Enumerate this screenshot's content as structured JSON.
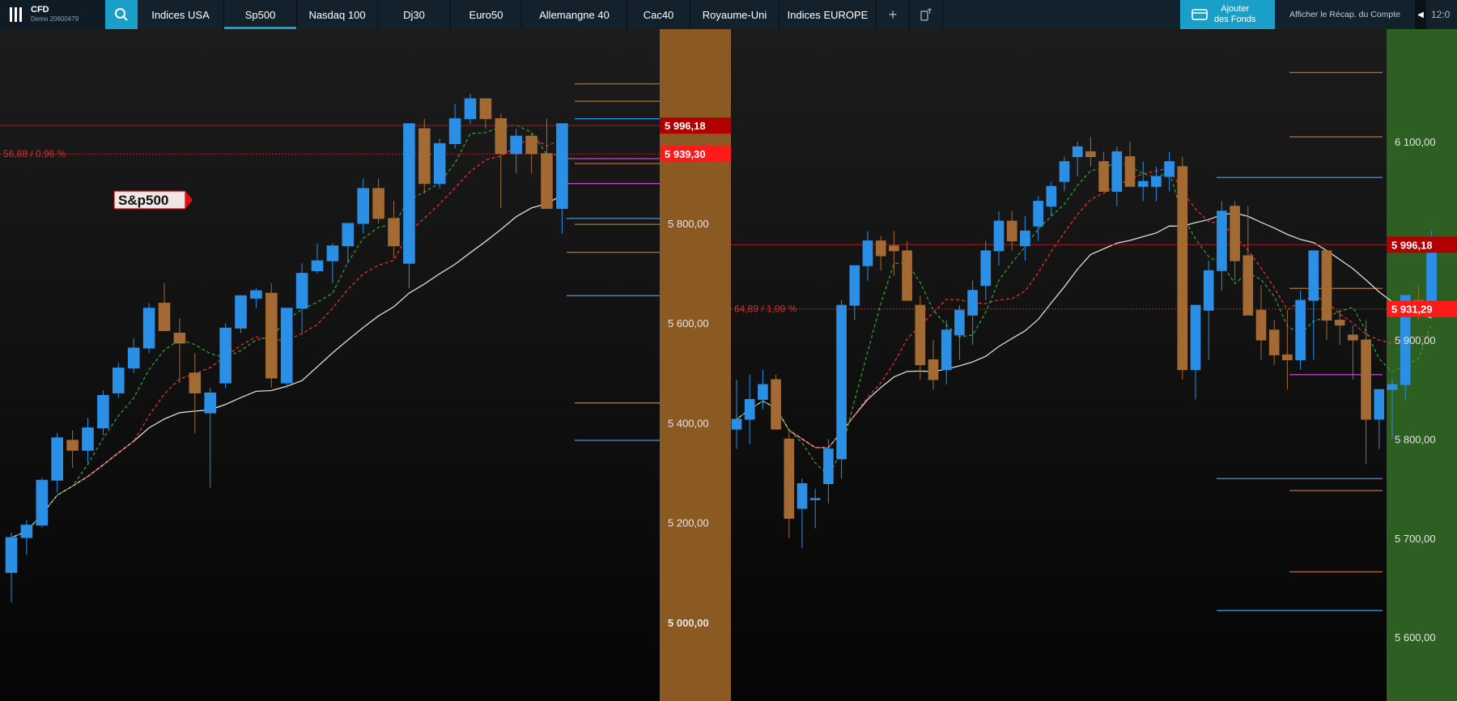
{
  "header": {
    "app_name": "CFD",
    "account": "Demo 20600479",
    "tabs": [
      {
        "label": "Indices USA",
        "active": false
      },
      {
        "label": "Sp500",
        "active": true
      },
      {
        "label": "Nasdaq 100",
        "active": false
      },
      {
        "label": "Dj30",
        "active": false
      },
      {
        "label": "Euro50",
        "active": false
      },
      {
        "label": "Allemangne 40",
        "active": false
      },
      {
        "label": "Cac40",
        "active": false
      },
      {
        "label": "Royaume-Uni",
        "active": false
      },
      {
        "label": "Indices EUROPE",
        "active": false
      }
    ],
    "add_tab": "+",
    "fund_button": "Ajouter\ndes Fonds",
    "recap_link": "Afficher le Récap. du Compte",
    "clock": "12:0"
  },
  "left_chart": {
    "symbol": "S&p500",
    "change_label": "56,88 / 0,96 %",
    "price_tags": [
      "5 996,18",
      "5 939,30"
    ],
    "y_labels": [
      "5 800,00",
      "5 600,00",
      "5 400,00",
      "5 200,00",
      "5 000,00"
    ],
    "axis_color": "#8b5a22"
  },
  "right_chart": {
    "change_label": "64,89 / 1,09 %",
    "price_tags": [
      "5 996,18",
      "5 931,29"
    ],
    "y_labels": [
      "6 100,00",
      "5 900,00",
      "5 800,00",
      "5 700,00",
      "5 600,00"
    ],
    "axis_color": "#2d5e22"
  },
  "colors": {
    "up": "#2b8fe5",
    "down": "#a36a33",
    "tab_active": "#1aa0c8",
    "resistance": "#c00000"
  },
  "chart_data": [
    {
      "type": "candlestick",
      "name": "left",
      "ohlc": [
        [
          5100,
          5180,
          5040,
          5170
        ],
        [
          5170,
          5205,
          5135,
          5195
        ],
        [
          5195,
          5290,
          5190,
          5285
        ],
        [
          5285,
          5380,
          5260,
          5370
        ],
        [
          5365,
          5385,
          5310,
          5345
        ],
        [
          5345,
          5410,
          5320,
          5390
        ],
        [
          5390,
          5465,
          5375,
          5455
        ],
        [
          5460,
          5520,
          5450,
          5510
        ],
        [
          5510,
          5570,
          5500,
          5550
        ],
        [
          5550,
          5640,
          5540,
          5630
        ],
        [
          5640,
          5680,
          5600,
          5585
        ],
        [
          5580,
          5610,
          5480,
          5560
        ],
        [
          5500,
          5540,
          5380,
          5460
        ],
        [
          5420,
          5470,
          5270,
          5460
        ],
        [
          5480,
          5600,
          5470,
          5590
        ],
        [
          5590,
          5650,
          5580,
          5655
        ],
        [
          5650,
          5670,
          5630,
          5665
        ],
        [
          5660,
          5680,
          5470,
          5490
        ],
        [
          5480,
          5600,
          5470,
          5630
        ],
        [
          5630,
          5720,
          5580,
          5700
        ],
        [
          5705,
          5760,
          5700,
          5725
        ],
        [
          5725,
          5760,
          5680,
          5755
        ],
        [
          5755,
          5780,
          5720,
          5800
        ],
        [
          5800,
          5890,
          5780,
          5870
        ],
        [
          5870,
          5890,
          5800,
          5810
        ],
        [
          5810,
          5845,
          5730,
          5755
        ],
        [
          5720,
          5780,
          5670,
          6000
        ],
        [
          5990,
          6010,
          5860,
          5880
        ],
        [
          5880,
          5970,
          5870,
          5960
        ],
        [
          5960,
          6040,
          5950,
          6010
        ],
        [
          6010,
          6060,
          6000,
          6050
        ],
        [
          6050,
          6050,
          5990,
          6010
        ],
        [
          6010,
          6020,
          5830,
          5940
        ],
        [
          5940,
          5990,
          5900,
          5975
        ],
        [
          5975,
          5980,
          5900,
          5940
        ],
        [
          5940,
          6010,
          5830,
          5830
        ],
        [
          5830,
          6000,
          5780,
          6000
        ]
      ]
    },
    {
      "type": "candlestick",
      "name": "right",
      "ohlc": [
        [
          5810,
          5860,
          5790,
          5820
        ],
        [
          5820,
          5865,
          5795,
          5840
        ],
        [
          5840,
          5870,
          5830,
          5855
        ],
        [
          5860,
          5865,
          5810,
          5810
        ],
        [
          5800,
          5810,
          5700,
          5720
        ],
        [
          5730,
          5760,
          5690,
          5755
        ],
        [
          5740,
          5750,
          5710,
          5740
        ],
        [
          5755,
          5800,
          5735,
          5790
        ],
        [
          5780,
          5940,
          5760,
          5935
        ],
        [
          5935,
          5975,
          5920,
          5975
        ],
        [
          5975,
          6010,
          5960,
          6000
        ],
        [
          6000,
          6005,
          5970,
          5985
        ],
        [
          5995,
          6010,
          5965,
          5990
        ],
        [
          5990,
          6000,
          5940,
          5940
        ],
        [
          5935,
          5945,
          5860,
          5875
        ],
        [
          5880,
          5900,
          5850,
          5860
        ],
        [
          5870,
          5920,
          5855,
          5910
        ],
        [
          5905,
          5935,
          5880,
          5930
        ],
        [
          5925,
          5960,
          5895,
          5950
        ],
        [
          5955,
          6000,
          5940,
          5990
        ],
        [
          5990,
          6030,
          5975,
          6020
        ],
        [
          6020,
          6030,
          5990,
          6000
        ],
        [
          5995,
          6025,
          5980,
          6010
        ],
        [
          6015,
          6045,
          6000,
          6040
        ],
        [
          6035,
          6060,
          6025,
          6055
        ],
        [
          6060,
          6085,
          6050,
          6080
        ],
        [
          6085,
          6100,
          6065,
          6095
        ],
        [
          6090,
          6105,
          6075,
          6085
        ],
        [
          6080,
          6090,
          6050,
          6050
        ],
        [
          6050,
          6095,
          6035,
          6090
        ],
        [
          6085,
          6100,
          6055,
          6055
        ],
        [
          6055,
          6080,
          6040,
          6060
        ],
        [
          6055,
          6075,
          6040,
          6065
        ],
        [
          6065,
          6090,
          6050,
          6080
        ],
        [
          6075,
          6085,
          5860,
          5870
        ],
        [
          5870,
          5935,
          5840,
          5935
        ],
        [
          5930,
          5980,
          5880,
          5970
        ],
        [
          5970,
          6040,
          5950,
          6030
        ],
        [
          6035,
          6040,
          5960,
          5980
        ],
        [
          5985,
          6035,
          5930,
          5925
        ],
        [
          5930,
          5955,
          5880,
          5900
        ],
        [
          5910,
          5920,
          5875,
          5885
        ],
        [
          5885,
          5930,
          5850,
          5880
        ],
        [
          5880,
          5950,
          5870,
          5940
        ],
        [
          5940,
          5980,
          5880,
          5990
        ],
        [
          5990,
          5990,
          5900,
          5920
        ],
        [
          5920,
          5930,
          5895,
          5915
        ],
        [
          5905,
          5915,
          5860,
          5900
        ],
        [
          5900,
          5920,
          5775,
          5820
        ],
        [
          5820,
          5850,
          5790,
          5850
        ],
        [
          5850,
          5860,
          5800,
          5855
        ],
        [
          5855,
          5945,
          5840,
          5945
        ],
        [
          5940,
          5955,
          5920,
          5935
        ],
        [
          5935,
          6010,
          5930,
          6000
        ]
      ]
    }
  ]
}
